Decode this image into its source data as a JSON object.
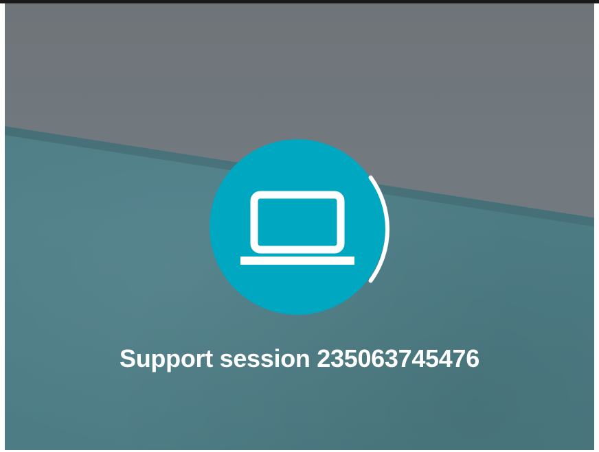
{
  "session": {
    "label_prefix": "Support session",
    "session_id": "235063745476",
    "progress": 0.2
  },
  "icons": {
    "avatar": "laptop-icon"
  },
  "colors": {
    "avatar_circle": "#00a7c0",
    "progress_ring": "#ffffff",
    "label_text": "#ffffff",
    "wall": "#717980",
    "surface": "#4e7f88"
  }
}
